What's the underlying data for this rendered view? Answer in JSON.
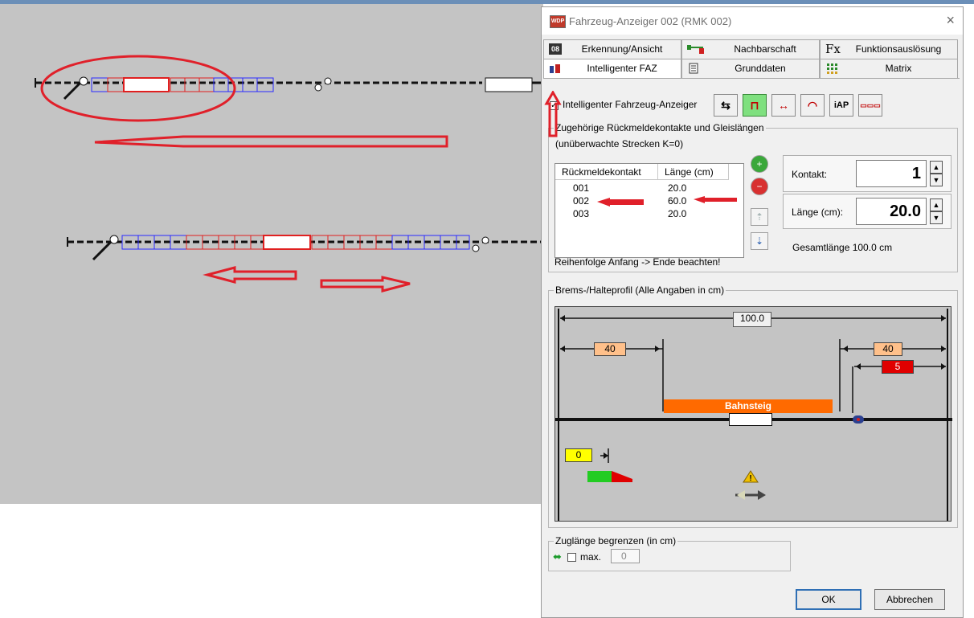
{
  "dialog": {
    "title": "Fahrzeug-Anzeiger 002 (RMK 002)",
    "close_glyph": "×",
    "app_icon_label": "WDP"
  },
  "tabs_row1": [
    {
      "icon": "08",
      "label": "Erkennung/Ansicht"
    },
    {
      "icon": "neighbor-icon",
      "label": "Nachbarschaft"
    },
    {
      "icon": "Fx",
      "label": "Funktionsauslösung"
    }
  ],
  "tabs_row2": [
    {
      "icon": "faz-icon",
      "label": "Intelligenter FAZ"
    },
    {
      "icon": "document-icon",
      "label": "Grunddaten"
    },
    {
      "icon": "matrix-icon",
      "label": "Matrix"
    }
  ],
  "faz": {
    "checkbox_label": "Intelligenter Fahrzeug-Anzeiger",
    "checked": true,
    "toolbar": [
      {
        "name": "swap-direction-icon",
        "glyph": "⇆",
        "active": false
      },
      {
        "name": "platform-icon",
        "glyph": "⊓",
        "active": true
      },
      {
        "name": "split-icon",
        "glyph": "↔",
        "active": false
      },
      {
        "name": "speedometer-icon",
        "glyph": "◠",
        "active": false
      },
      {
        "name": "iap-button",
        "glyph": "iAP",
        "active": false
      },
      {
        "name": "train-icon",
        "glyph": "▭▭▭",
        "active": false
      }
    ]
  },
  "contacts_group": {
    "title": "Zugehörige Rückmeldekontakte und Gleislängen",
    "subtitle": "(unüberwachte Strecken K=0)",
    "columns": [
      "Rückmeldekontakt",
      "Länge (cm)"
    ],
    "rows": [
      {
        "contact": "001",
        "length": "20.0"
      },
      {
        "contact": "002",
        "length": "60.0"
      },
      {
        "contact": "003",
        "length": "20.0"
      }
    ],
    "note": "Reihenfolge Anfang -> Ende beachten!",
    "kontakt_label": "Kontakt:",
    "kontakt_value": "1",
    "laenge_label": "Länge (cm):",
    "laenge_value": "20.0",
    "gesamt": "Gesamtlänge 100.0 cm"
  },
  "profile_group": {
    "title": "Brems-/Halteprofil (Alle Angaben in cm)",
    "total": "100.0",
    "left_brake": "40",
    "right_brake": "40",
    "right_stop": "5",
    "platform_label": "Bahnsteig",
    "start_value": "0"
  },
  "zug_group": {
    "title": "Zuglänge begrenzen (in cm)",
    "max_label": "max.",
    "max_value": "0"
  },
  "buttons": {
    "ok": "OK",
    "cancel": "Abbrechen"
  },
  "colors": {
    "canvas_bg": "#c4c4c4",
    "annotation_red": "#e0202a",
    "platform_orange": "#ff6a00",
    "brake_tag": "#ffc08a",
    "stop_tag": "#e00000",
    "start_tag": "#ffff00",
    "active_tool": "#7fe07f"
  }
}
